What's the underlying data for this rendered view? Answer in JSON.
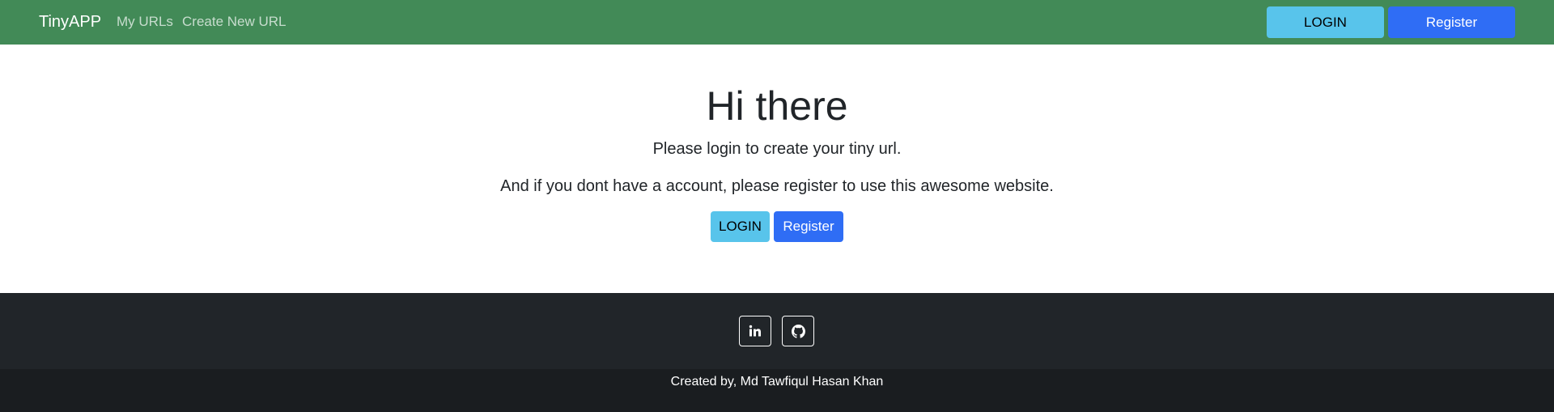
{
  "navbar": {
    "brand": "TinyAPP",
    "links": [
      "My URLs",
      "Create New URL"
    ],
    "login_label": "LOGIN",
    "register_label": "Register"
  },
  "main": {
    "title": "Hi there",
    "line1": "Please login to create your tiny url.",
    "line2": "And if you dont have a account, please register to use this awesome website.",
    "login_label": "LOGIN",
    "register_label": "Register"
  },
  "footer": {
    "social_icons": [
      "linkedin-icon",
      "github-icon"
    ],
    "credit": "Created by, Md Tawfiqul Hasan Khan"
  },
  "colors": {
    "navbar_bg": "#428a57",
    "login_btn": "#58c4eb",
    "register_btn": "#2f6df5",
    "footer_bg": "#212529",
    "copyright_bg": "#1a1d20"
  }
}
